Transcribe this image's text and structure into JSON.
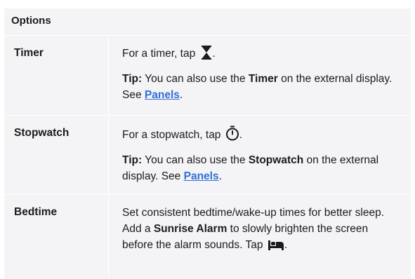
{
  "header": "Options",
  "rows": [
    {
      "label": "Timer",
      "intro": "For a timer, tap",
      "intro_end": ".",
      "icon": "hourglass-icon",
      "tip_label": "Tip:",
      "tip_pre": "You can also use the",
      "tip_bold": "Timer",
      "tip_post": "on the external display. See",
      "link": "Panels",
      "tip_end": "."
    },
    {
      "label": "Stopwatch",
      "intro": "For a stopwatch, tap",
      "intro_end": ".",
      "icon": "stopwatch-icon",
      "tip_label": "Tip:",
      "tip_pre": "You can also use the",
      "tip_bold": "Stopwatch",
      "tip_post": "on the external display. See",
      "link": "Panels",
      "tip_end": "."
    },
    {
      "label": "Bedtime",
      "text_pre": "Set consistent bedtime/wake-up times for better sleep. Add a",
      "text_bold": "Sunrise Alarm",
      "text_post": "to slowly brighten the screen before the alarm sounds. Tap",
      "text_end": ".",
      "icon": "bed-icon"
    }
  ]
}
